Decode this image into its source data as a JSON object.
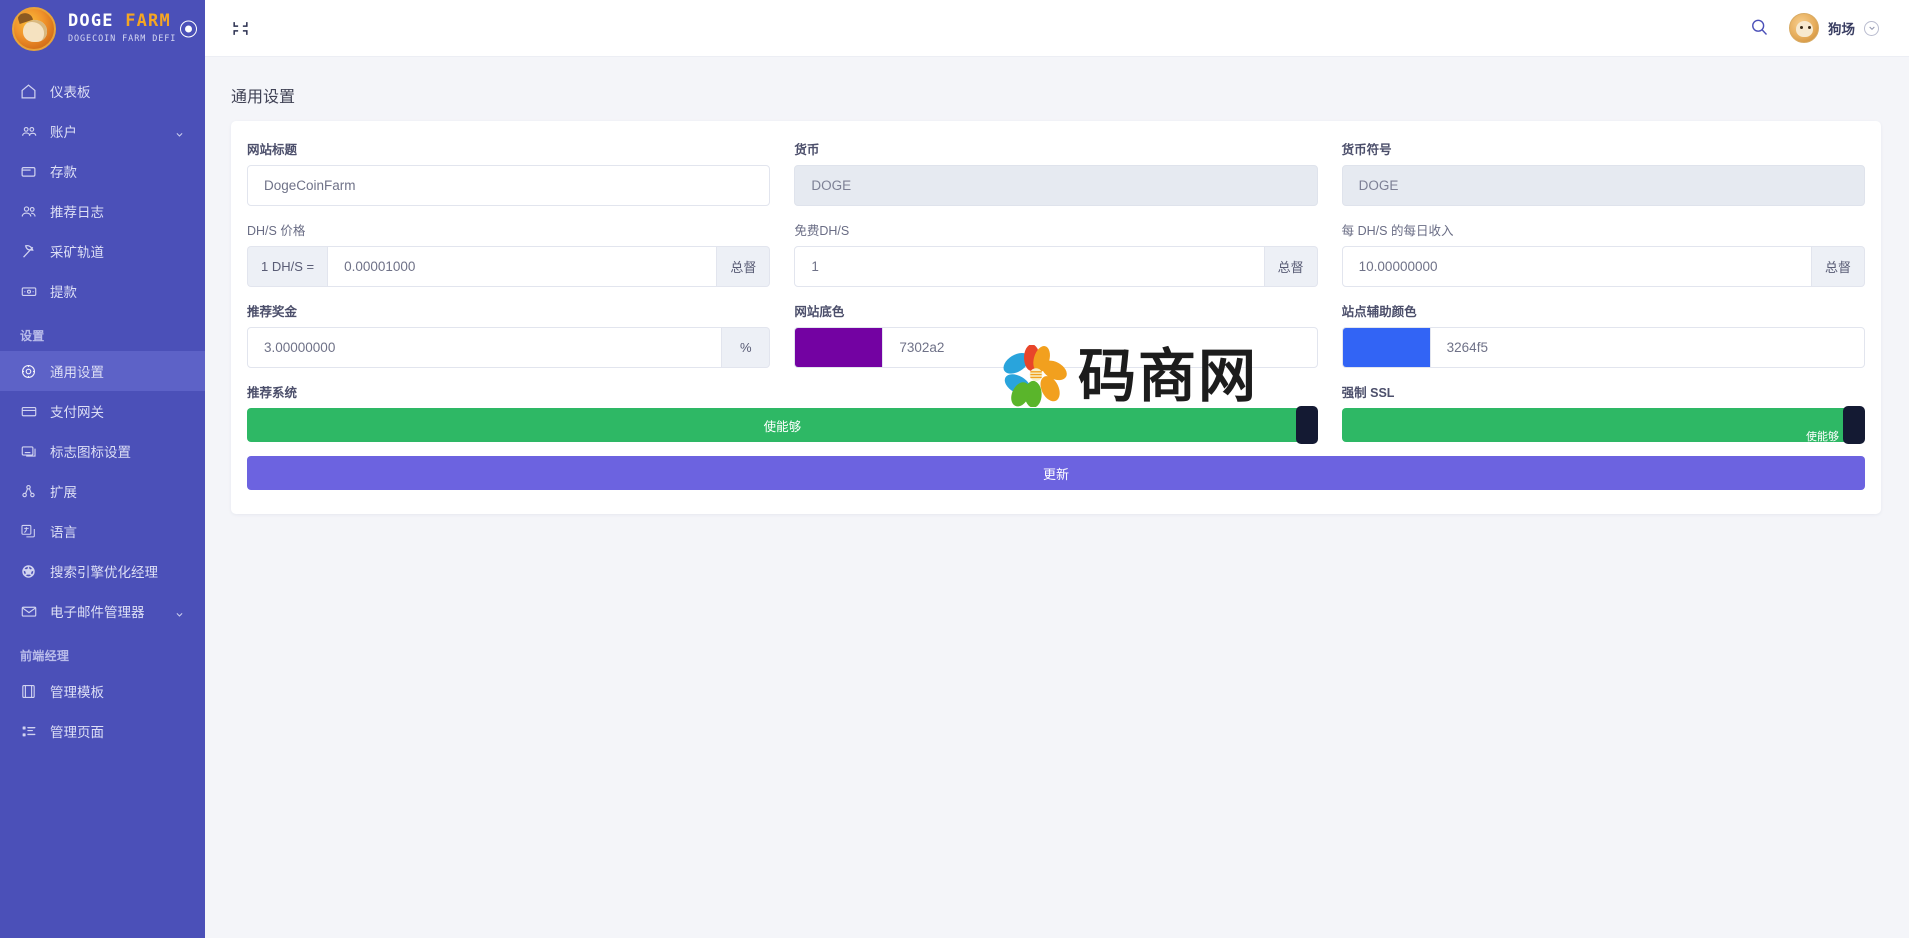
{
  "brand": {
    "title_part1": "DOGE",
    "title_part2": "FARM",
    "subtitle": "DOGECOIN FARM DEFI",
    "logo_icon": "doge-logo-icon",
    "toggle_icon": "radio-dot-icon"
  },
  "sidebar": {
    "items": [
      {
        "label": "仪表板",
        "icon": "home-icon",
        "active": false,
        "caret": false
      },
      {
        "label": "账户",
        "icon": "users-group-icon",
        "active": false,
        "caret": true
      },
      {
        "label": "存款",
        "icon": "wallet-icon",
        "active": false,
        "caret": false
      },
      {
        "label": "推荐日志",
        "icon": "people-icon",
        "active": false,
        "caret": false
      },
      {
        "label": "采矿轨道",
        "icon": "pickaxe-icon",
        "active": false,
        "caret": false
      },
      {
        "label": "提款",
        "icon": "card-money-icon",
        "active": false,
        "caret": false
      }
    ],
    "section_settings": "设置",
    "settings_items": [
      {
        "label": "通用设置",
        "icon": "gear-circle-icon",
        "active": true,
        "caret": false
      },
      {
        "label": "支付网关",
        "icon": "credit-card-icon",
        "active": false,
        "caret": false
      },
      {
        "label": "标志图标设置",
        "icon": "logo-image-icon",
        "active": false,
        "caret": false
      },
      {
        "label": "扩展",
        "icon": "extension-nodes-icon",
        "active": false,
        "caret": false
      },
      {
        "label": "语言",
        "icon": "language-icon",
        "active": false,
        "caret": false
      },
      {
        "label": "搜索引擎优化经理",
        "icon": "globe-icon",
        "active": false,
        "caret": false
      },
      {
        "label": "电子邮件管理器",
        "icon": "mail-icon",
        "active": false,
        "caret": true
      }
    ],
    "section_frontend": "前端经理",
    "frontend_items": [
      {
        "label": "管理模板",
        "icon": "template-icon",
        "active": false,
        "caret": false
      },
      {
        "label": "管理页面",
        "icon": "list-pages-icon",
        "active": false,
        "caret": false
      }
    ]
  },
  "topbar": {
    "collapse_icon": "collapse-arrows-icon",
    "search_icon": "search-icon",
    "avatar_icon": "user-avatar-icon",
    "user_name": "狗场",
    "chevron_icon": "chevron-down-icon"
  },
  "page": {
    "title": "通用设置"
  },
  "form": {
    "site_title": {
      "label": "网站标题",
      "value": "DogeCoinFarm"
    },
    "currency": {
      "label": "货币",
      "value": "DOGE",
      "readonly": true
    },
    "currency_symbol": {
      "label": "货币符号",
      "value": "DOGE",
      "readonly": true
    },
    "dhs_price": {
      "label": "DH/S 价格",
      "prefix": "1 DH/S =",
      "value": "0.00001000",
      "suffix": "总督"
    },
    "free_dhs": {
      "label": "免费DH/S",
      "value": "1",
      "suffix": "总督"
    },
    "daily_income_per_dhs": {
      "label": "每 DH/S 的每日收入",
      "value": "10.00000000",
      "suffix": "总督"
    },
    "referral_bonus": {
      "label": "推荐奖金",
      "value": "3.00000000",
      "suffix": "%"
    },
    "site_base_color": {
      "label": "网站底色",
      "value": "7302a2",
      "swatch": "#7302a2"
    },
    "site_secondary_color": {
      "label": "站点辅助颜色",
      "value": "3264f5",
      "swatch": "#3264f5"
    },
    "referral_system": {
      "label": "推荐系统",
      "state_label": "使能够",
      "enabled": true
    },
    "force_ssl": {
      "label": "强制 SSL",
      "state_label": "使能够",
      "enabled": true
    },
    "update_button": "更新"
  },
  "watermark": {
    "text": "码商网",
    "flower_icon": "flower-logo-icon"
  },
  "colors": {
    "sidebar": "#4b50b8",
    "sidebar_active": "#5d62c7",
    "accent_purple": "#6c63e0",
    "toggle_green": "#2eb865",
    "base_color": "#7302a2",
    "secondary_color": "#3264f5"
  }
}
